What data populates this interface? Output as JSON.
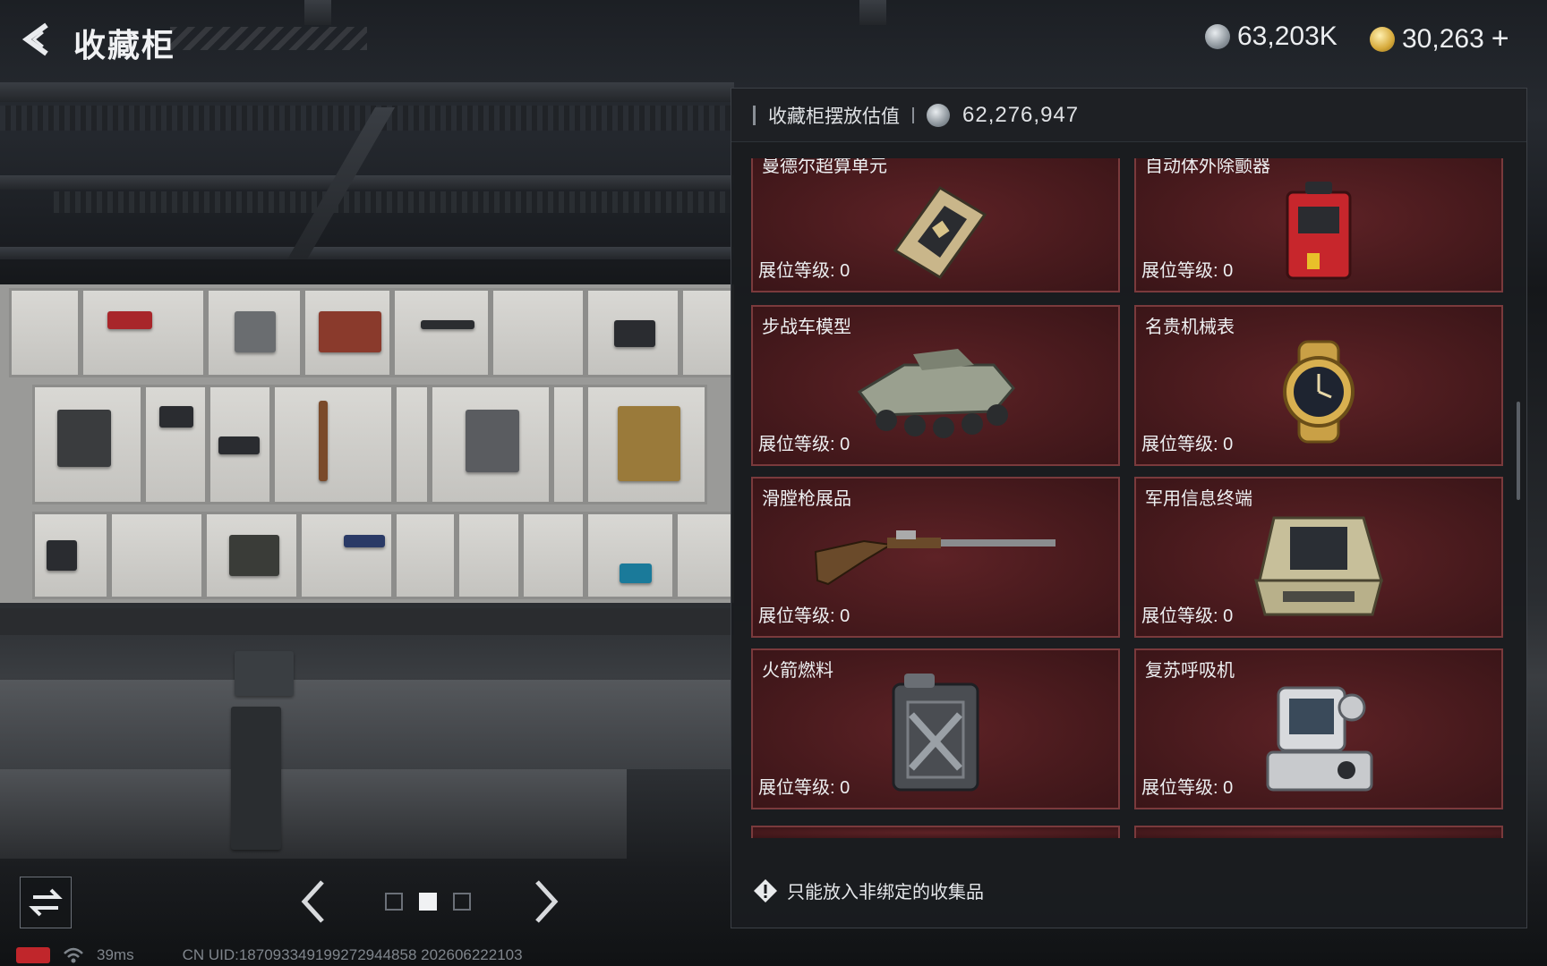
{
  "header": {
    "title": "收藏柜",
    "currencies": [
      {
        "icon": "silver-coin-icon",
        "amount": "63,203K"
      },
      {
        "icon": "gold-coin-icon",
        "amount": "30,263"
      }
    ],
    "add_label": "+"
  },
  "panel": {
    "valuation_label": "收藏柜摆放估值",
    "valuation_amount": "62,276,947",
    "items": [
      {
        "name": "曼德尔超算单元",
        "level": "展位等级: 0",
        "icon": "chip-icon"
      },
      {
        "name": "自动体外除颤器",
        "level": "展位等级: 0",
        "icon": "defibrillator-icon"
      },
      {
        "name": "步战车模型",
        "level": "展位等级: 0",
        "icon": "ifv-model-icon"
      },
      {
        "name": "名贵机械表",
        "level": "展位等级: 0",
        "icon": "watch-icon"
      },
      {
        "name": "滑膛枪展品",
        "level": "展位等级: 0",
        "icon": "musket-icon"
      },
      {
        "name": "军用信息终端",
        "level": "展位等级: 0",
        "icon": "terminal-icon"
      },
      {
        "name": "火箭燃料",
        "level": "展位等级: 0",
        "icon": "jerrycan-icon"
      },
      {
        "name": "复苏呼吸机",
        "level": "展位等级: 0",
        "icon": "ventilator-icon"
      }
    ],
    "footer_note": "只能放入非绑定的收集品"
  },
  "nav": {
    "pages": 3,
    "active_page": 2
  },
  "status": {
    "ping": "39ms",
    "uid": "CN UID:18709334919927294485​8 2026062221​03"
  },
  "colors": {
    "card_bg": "#481a1d",
    "card_border": "#7a3a3c",
    "panel_bg": "#1a1c1f"
  }
}
